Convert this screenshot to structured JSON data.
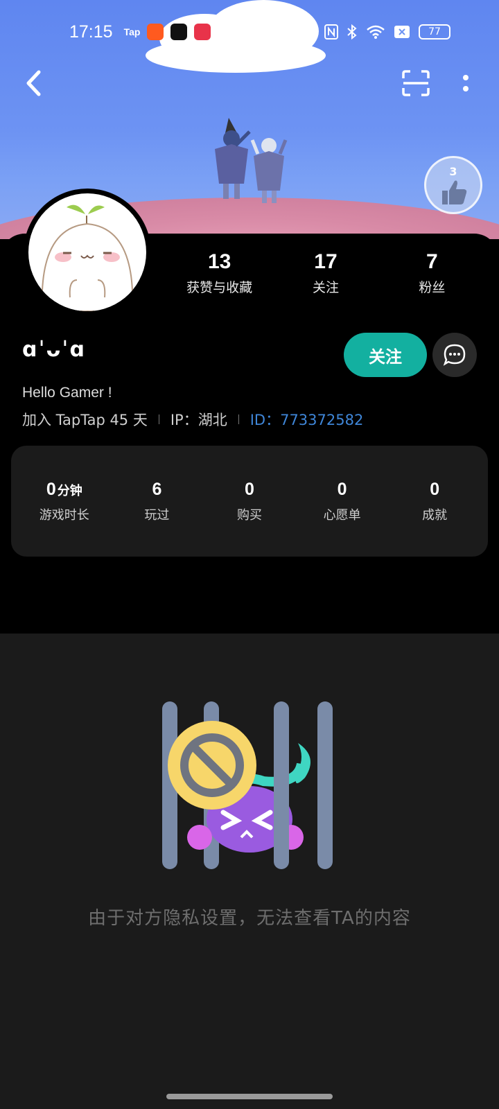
{
  "status_bar": {
    "time": "17:15",
    "app_icons": [
      "Tap",
      "taobao-icon",
      "tiktok-icon",
      "video-icon",
      "app-icon"
    ],
    "battery": "77"
  },
  "header": {
    "back_icon": "chevron-left-icon",
    "scan_icon": "scan-icon",
    "more_icon": "more-vertical-icon",
    "badge_number": "3"
  },
  "profile": {
    "nickname": "ɑˈᴗˈɑ",
    "bio": "Hello Gamer !",
    "joined": "加入 TapTap 45 天",
    "ip": "IP：湖北",
    "id": "ID：773372582",
    "follow_label": "关注"
  },
  "counts": [
    {
      "value": "13",
      "label": "获赞与收藏"
    },
    {
      "value": "17",
      "label": "关注"
    },
    {
      "value": "7",
      "label": "粉丝"
    }
  ],
  "stats": [
    {
      "value": "0",
      "unit": "分钟",
      "label": "游戏时长"
    },
    {
      "value": "6",
      "unit": "",
      "label": "玩过"
    },
    {
      "value": "0",
      "unit": "",
      "label": "购买"
    },
    {
      "value": "0",
      "unit": "",
      "label": "心愿单"
    },
    {
      "value": "0",
      "unit": "",
      "label": "成就"
    }
  ],
  "private_notice": "由于对方隐私设置，无法查看TA的内容",
  "colors": {
    "accent": "#13b0a0",
    "id_link": "#3f86d8",
    "card_bg": "#1b1b1b"
  }
}
